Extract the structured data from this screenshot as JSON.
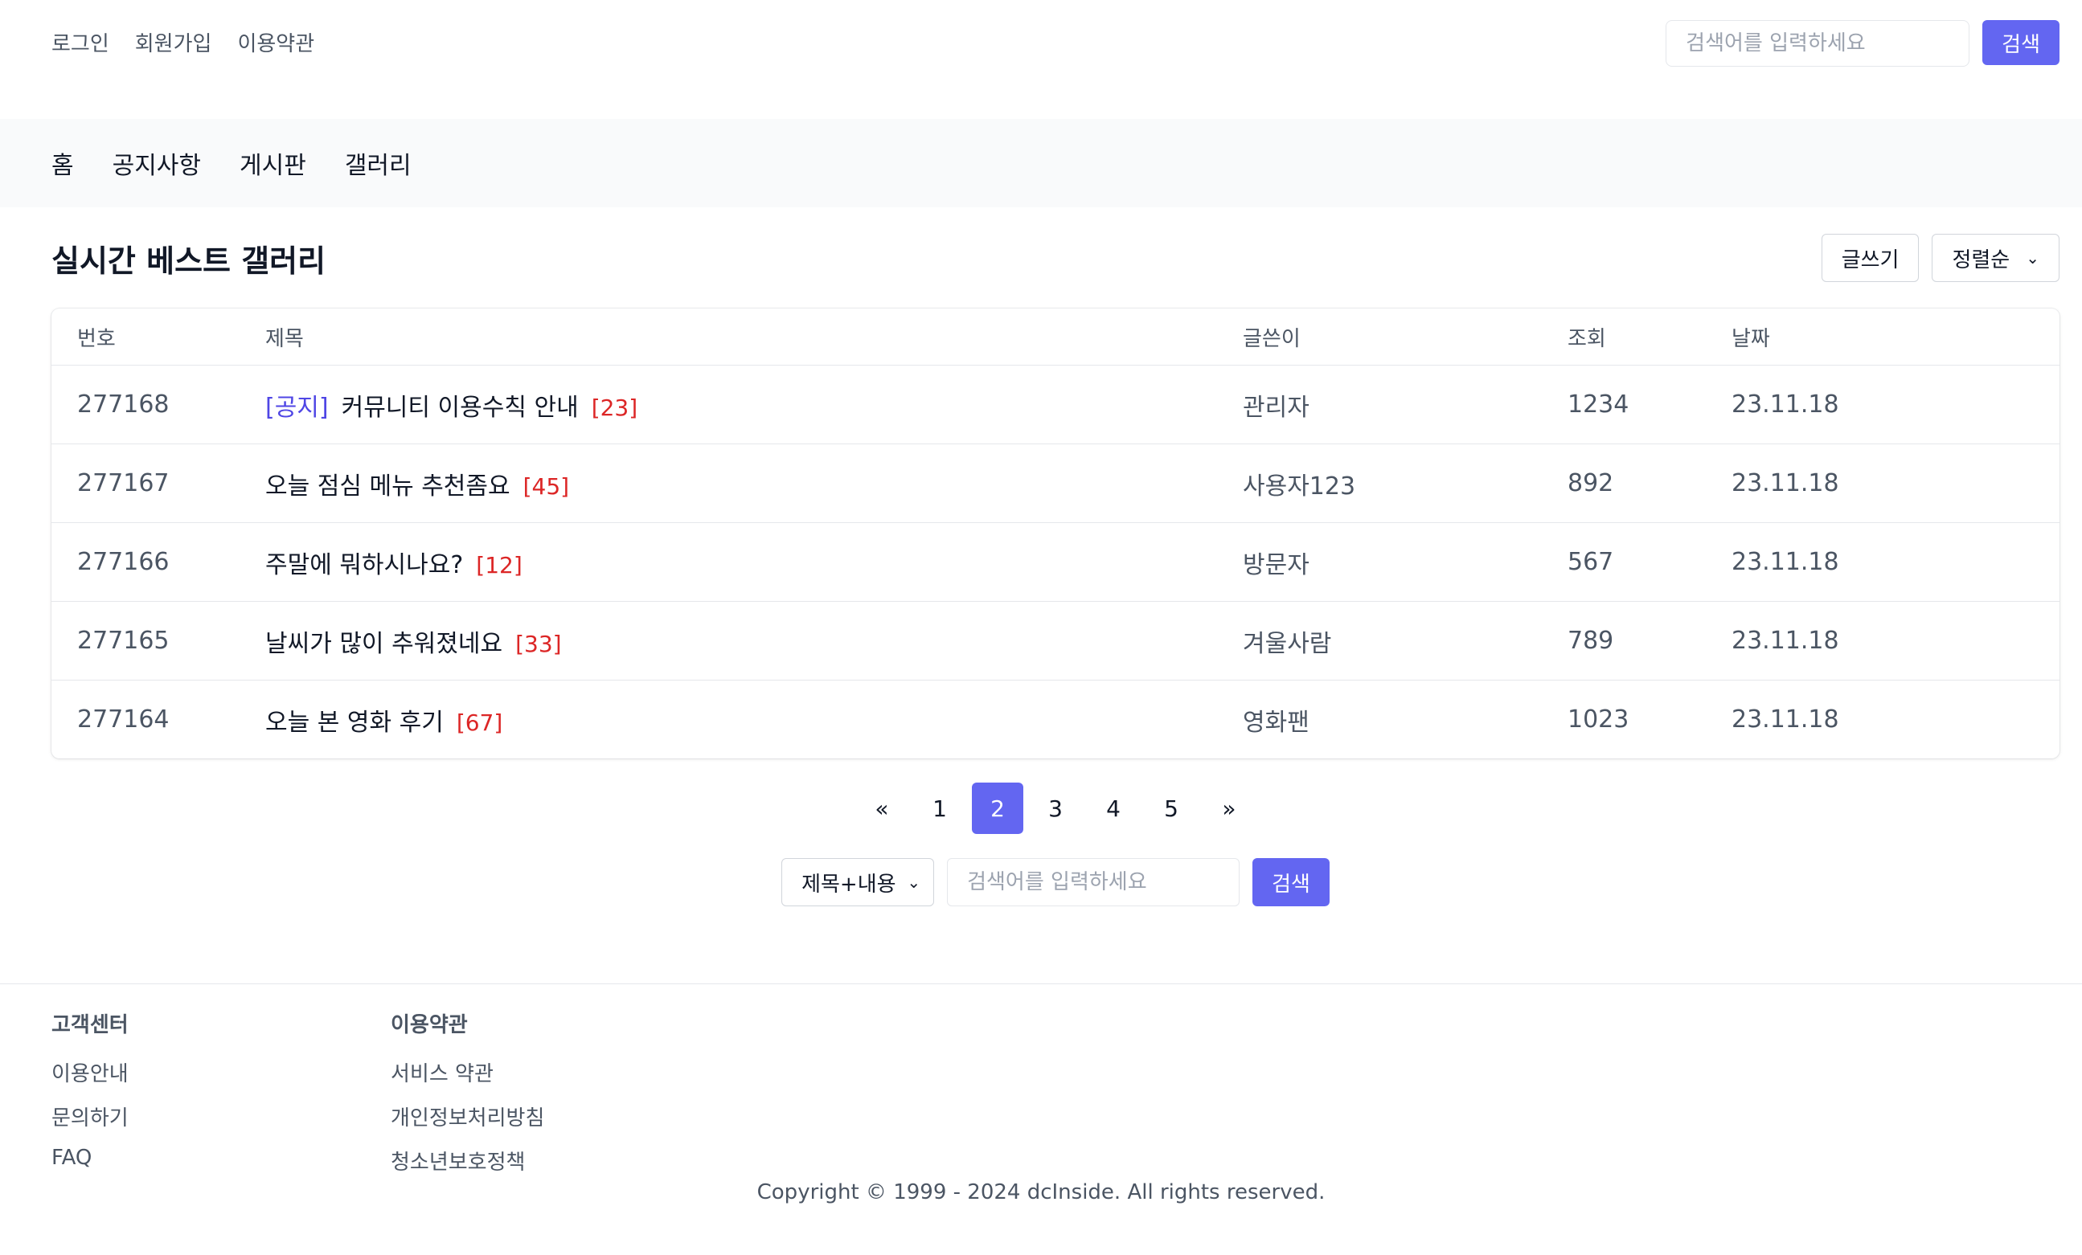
{
  "top_nav": {
    "items": [
      "로그인",
      "회원가입",
      "이용약관"
    ],
    "search_placeholder": "검색어를 입력하세요",
    "search_button": "검색"
  },
  "main_nav": {
    "items": [
      "홈",
      "공지사항",
      "게시판",
      "갤러리"
    ]
  },
  "page": {
    "title": "실시간 베스트 갤러리",
    "write_button": "글쓰기",
    "sort_label": "정렬순"
  },
  "board": {
    "headers": {
      "no": "번호",
      "title": "제목",
      "author": "글쓴이",
      "views": "조회",
      "date": "날짜"
    },
    "rows": [
      {
        "no": "277168",
        "notice": "[공지]",
        "title": "커뮤니티 이용수칙 안내",
        "comments": "[23]",
        "author": "관리자",
        "views": "1234",
        "date": "23.11.18"
      },
      {
        "no": "277167",
        "notice": "",
        "title": "오늘 점심 메뉴 추천좀요",
        "comments": "[45]",
        "author": "사용자123",
        "views": "892",
        "date": "23.11.18"
      },
      {
        "no": "277166",
        "notice": "",
        "title": "주말에 뭐하시나요?",
        "comments": "[12]",
        "author": "방문자",
        "views": "567",
        "date": "23.11.18"
      },
      {
        "no": "277165",
        "notice": "",
        "title": "날씨가 많이 추워졌네요",
        "comments": "[33]",
        "author": "겨울사람",
        "views": "789",
        "date": "23.11.18"
      },
      {
        "no": "277164",
        "notice": "",
        "title": "오늘 본 영화 후기",
        "comments": "[67]",
        "author": "영화팬",
        "views": "1023",
        "date": "23.11.18"
      }
    ]
  },
  "pagination": {
    "prev": "«",
    "pages": [
      "1",
      "2",
      "3",
      "4",
      "5"
    ],
    "current": "2",
    "next": "»"
  },
  "bottom_search": {
    "scope": "제목+내용",
    "placeholder": "검색어를 입력하세요",
    "button": "검색"
  },
  "footer": {
    "col1": {
      "title": "고객센터",
      "links": [
        "이용안내",
        "문의하기",
        "FAQ"
      ]
    },
    "col2": {
      "title": "이용약관",
      "links": [
        "서비스 약관",
        "개인정보처리방침",
        "청소년보호정책"
      ]
    },
    "copyright": "Copyright © 1999 - 2024 dcInside. All rights reserved."
  },
  "colors": {
    "accent": "#6366f1",
    "notice": "#4f46e5",
    "comment": "#dc2626"
  },
  "icons": {
    "sort_dropdown": "chevron-down-icon",
    "scope_dropdown": "chevron-down-icon"
  }
}
